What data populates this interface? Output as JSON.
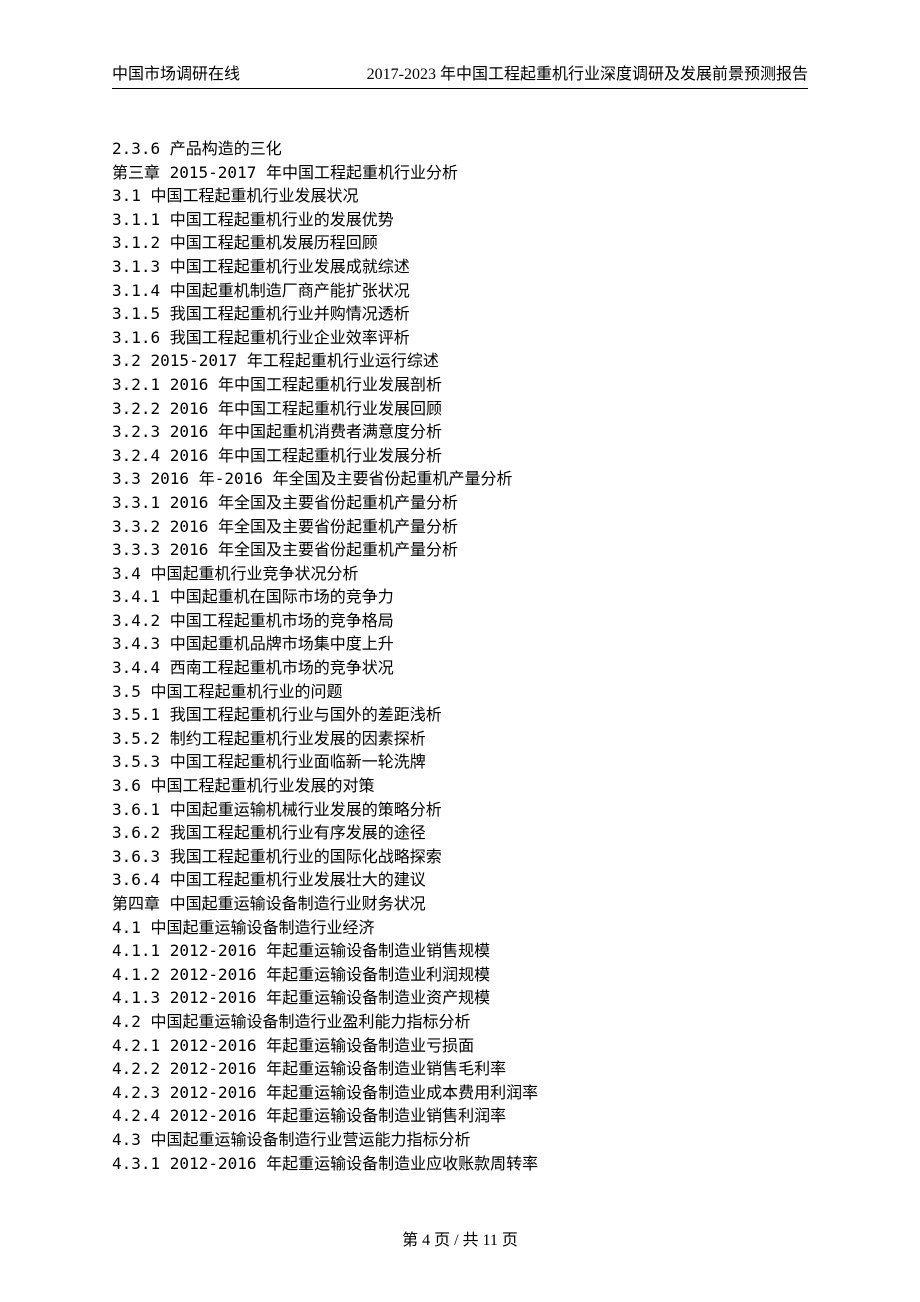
{
  "header": {
    "left": "中国市场调研在线",
    "right": "2017-2023 年中国工程起重机行业深度调研及发展前景预测报告"
  },
  "toc_lines": [
    "2.3.6  产品构造的三化",
    "第三章  2015-2017 年中国工程起重机行业分析",
    "3.1  中国工程起重机行业发展状况",
    "3.1.1  中国工程起重机行业的发展优势",
    "3.1.2  中国工程起重机发展历程回顾",
    "3.1.3  中国工程起重机行业发展成就综述",
    "3.1.4  中国起重机制造厂商产能扩张状况",
    "3.1.5  我国工程起重机行业并购情况透析",
    "3.1.6  我国工程起重机行业企业效率评析",
    "3.2  2015-2017 年工程起重机行业运行综述",
    "3.2.1  2016 年中国工程起重机行业发展剖析",
    "3.2.2  2016 年中国工程起重机行业发展回顾",
    "3.2.3  2016 年中国起重机消费者满意度分析",
    "3.2.4  2016 年中国工程起重机行业发展分析",
    "3.3  2016 年-2016 年全国及主要省份起重机产量分析",
    "3.3.1  2016 年全国及主要省份起重机产量分析",
    "3.3.2  2016 年全国及主要省份起重机产量分析",
    "3.3.3  2016 年全国及主要省份起重机产量分析",
    "3.4  中国起重机行业竞争状况分析",
    "3.4.1  中国起重机在国际市场的竞争力",
    "3.4.2  中国工程起重机市场的竞争格局",
    "3.4.3  中国起重机品牌市场集中度上升",
    "3.4.4  西南工程起重机市场的竞争状况",
    "3.5  中国工程起重机行业的问题",
    "3.5.1  我国工程起重机行业与国外的差距浅析",
    "3.5.2  制约工程起重机行业发展的因素探析",
    "3.5.3  中国工程起重机行业面临新一轮洗牌",
    "3.6  中国工程起重机行业发展的对策",
    "3.6.1  中国起重运输机械行业发展的策略分析",
    "3.6.2  我国工程起重机行业有序发展的途径",
    "3.6.3  我国工程起重机行业的国际化战略探索",
    "3.6.4  中国工程起重机行业发展壮大的建议",
    "第四章  中国起重运输设备制造行业财务状况",
    "4.1  中国起重运输设备制造行业经济",
    "4.1.1  2012-2016 年起重运输设备制造业销售规模",
    "4.1.2  2012-2016 年起重运输设备制造业利润规模",
    "4.1.3  2012-2016 年起重运输设备制造业资产规模",
    "4.2  中国起重运输设备制造行业盈利能力指标分析",
    "4.2.1  2012-2016 年起重运输设备制造业亏损面",
    "4.2.2  2012-2016 年起重运输设备制造业销售毛利率",
    "4.2.3  2012-2016 年起重运输设备制造业成本费用利润率",
    "4.2.4  2012-2016 年起重运输设备制造业销售利润率",
    "4.3  中国起重运输设备制造行业营运能力指标分析",
    "4.3.1  2012-2016 年起重运输设备制造业应收账款周转率"
  ],
  "footer": {
    "text": "第 4 页 / 共 11 页"
  }
}
